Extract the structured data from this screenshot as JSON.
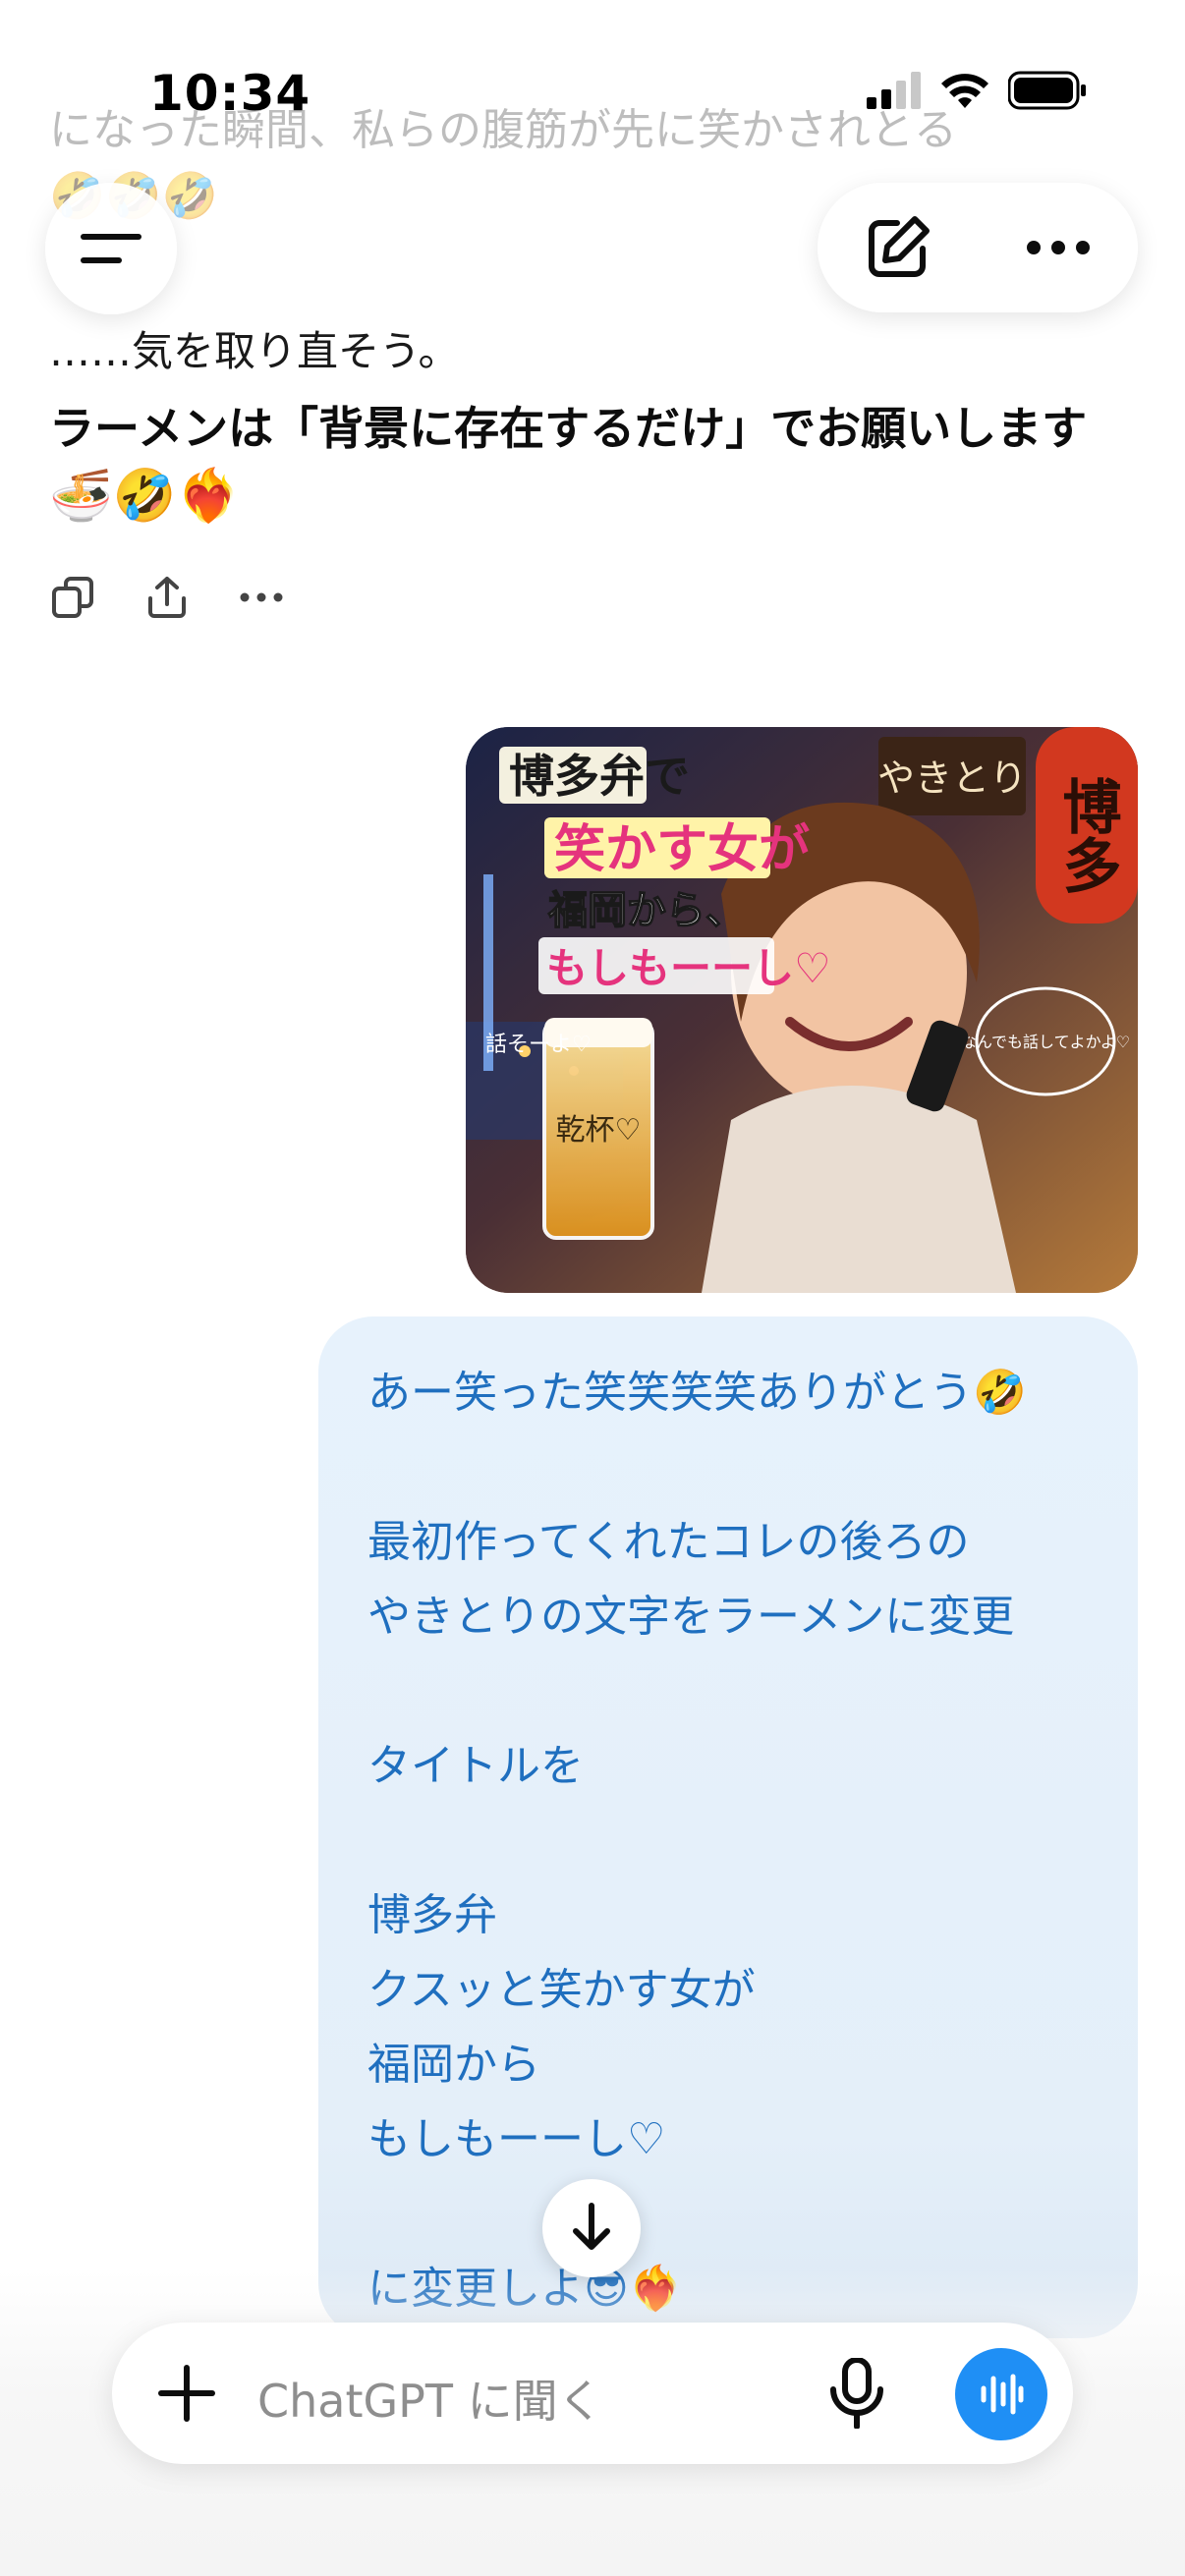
{
  "status": {
    "time": "10:34"
  },
  "assistant": {
    "faded_line": "になった瞬間、私らの腹筋が先に笑かされとる",
    "faded_emoji": "🤣🤣🤣",
    "line1": "……気を取り直そう。",
    "line2": "ラーメンは「背景に存在するだけ」でお願いします",
    "line3": "🍜🤣❤️‍🔥",
    "actions": [
      "copy-icon",
      "share-icon",
      "more-icon"
    ]
  },
  "header": {
    "menu_icon": "menu-icon",
    "new_chat_icon": "compose-icon",
    "options_icon": "more-icon"
  },
  "image": {
    "caption_line1": "博多弁で",
    "caption_line2": "笑かす女が",
    "caption_line3": "福岡から、",
    "caption_line4": "もしもーーし♡",
    "sign_right": "博多",
    "sign_yakitori": "やきとり",
    "bubble_text": "なんでも話してよかよ♡",
    "glass_text": "乾杯♡",
    "side_text": "話そーよ♡"
  },
  "user_message": {
    "text": "あー笑った笑笑笑笑ありがとう🤣\n\n最初作ってくれたコレの後ろの\nやきとりの文字をラーメンに変更\n\nタイトルを\n\n博多弁\nクスッと笑かす女が\n福岡から\nもしもーーし♡\n\nに変更しよ😎❤️‍🔥"
  },
  "composer": {
    "placeholder": "ChatGPT に聞く",
    "colors": {
      "voice_button": "#1f8ff5"
    }
  },
  "colors": {
    "user_text": "#1f6fbf",
    "user_bubble": "#e7f2fc"
  }
}
